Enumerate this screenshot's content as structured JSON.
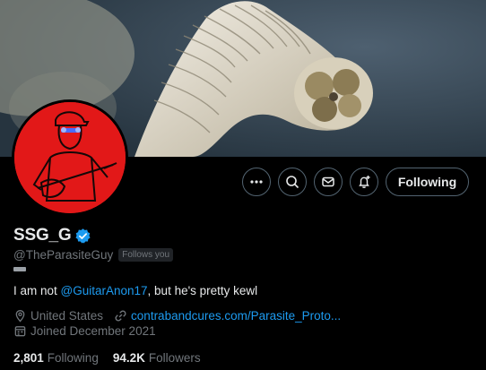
{
  "profile": {
    "display_name": "SSG_G",
    "handle": "@TheParasiteGuy",
    "follows_you": "Follows you",
    "bio_prefix": "I am not ",
    "bio_mention": "@GuitarAnon17",
    "bio_suffix": ", but he's pretty kewl",
    "location": "United States",
    "website": "contrabandcures.com/Parasite_Proto...",
    "joined": "Joined December 2021",
    "following_count": "2,801",
    "following_label": "Following",
    "followers_count": "94.2K",
    "followers_label": "Followers"
  },
  "actions": {
    "more_icon": "more-icon",
    "search_icon": "search-icon",
    "message_icon": "mail-icon",
    "notify_icon": "bell-plus-icon",
    "follow_label": "Following"
  },
  "colors": {
    "background": "#000000",
    "accent": "#1d9bf0",
    "muted": "#71767b",
    "border": "#536471",
    "avatar_red": "#e21818"
  }
}
